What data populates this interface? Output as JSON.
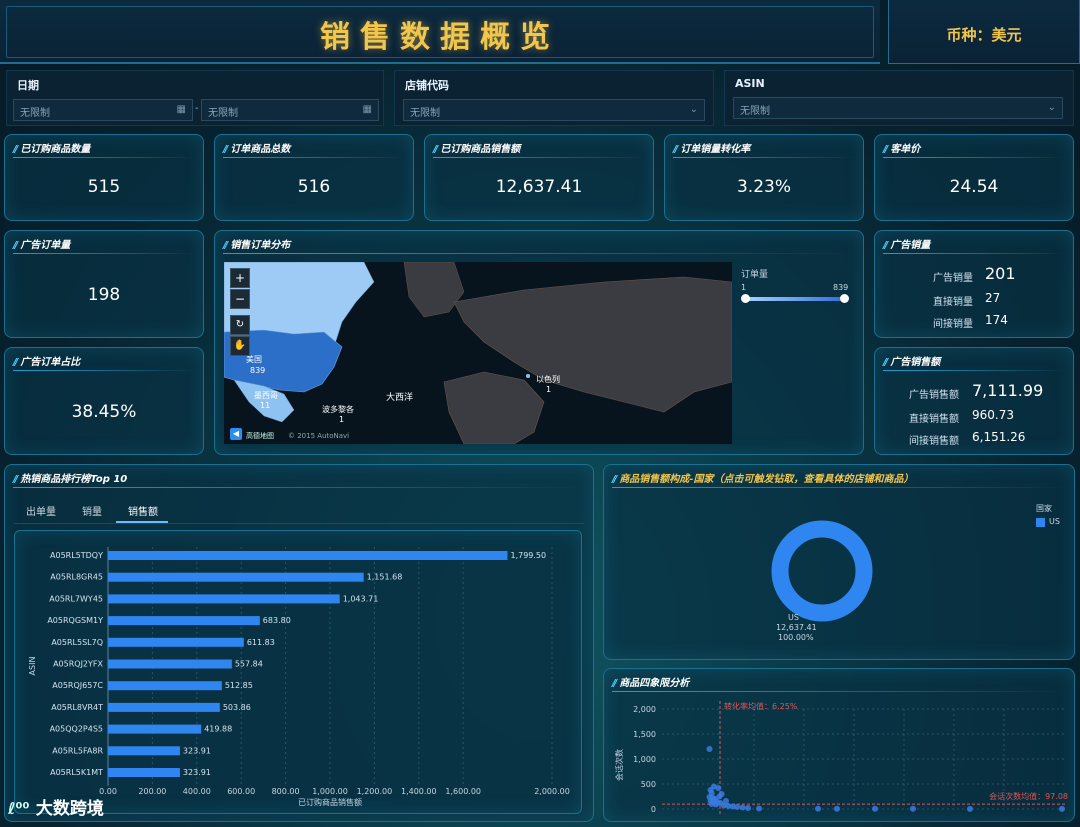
{
  "header": {
    "title": "销售数据概览",
    "currency": "币种：美元"
  },
  "filters": {
    "date": {
      "label": "日期",
      "start_placeholder": "无限制",
      "end_placeholder": "无限制",
      "sep": "-"
    },
    "store": {
      "label": "店铺代码",
      "value": "无限制"
    },
    "asin": {
      "label": "ASIN",
      "value": "无限制"
    }
  },
  "kpis": [
    {
      "title": "已订购商品数量",
      "value": "515"
    },
    {
      "title": "订单商品总数",
      "value": "516"
    },
    {
      "title": "已订购商品销售额",
      "value": "12,637.41"
    },
    {
      "title": "订单销量转化率",
      "value": "3.23%"
    },
    {
      "title": "客单价",
      "value": "24.54"
    }
  ],
  "ad_orders": {
    "title": "广告订单量",
    "value": "198"
  },
  "ad_ratio": {
    "title": "广告订单占比",
    "value": "38.45%"
  },
  "map": {
    "title": "销售订单分布",
    "legend_title": "订单量",
    "min": "1",
    "max": "839",
    "labels": {
      "us": "美国",
      "us_val": "839",
      "mx": "墨西哥",
      "mx_val": "11",
      "pr": "波多黎各",
      "pr_val": "1",
      "il": "以色列",
      "il_val": "1",
      "ocean": "大西洋"
    },
    "attribution": "高德地图",
    "copyright": "© 2015 AutoNavi"
  },
  "ad_sales_qty": {
    "title": "广告销量",
    "rows": [
      {
        "label": "广告销量",
        "value": "201"
      },
      {
        "label": "直接销量",
        "value": "27"
      },
      {
        "label": "间接销量",
        "value": "174"
      }
    ]
  },
  "ad_sales_amt": {
    "title": "广告销售额",
    "rows": [
      {
        "label": "广告销售额",
        "value": "7,111.99"
      },
      {
        "label": "直接销售额",
        "value": "960.73"
      },
      {
        "label": "间接销售额",
        "value": "6,151.26"
      }
    ]
  },
  "top10": {
    "title": "热销商品排行榜Top 10",
    "tabs": [
      "出单量",
      "销量",
      "销售额"
    ],
    "active_tab": 2
  },
  "pie": {
    "title": "商品销售额构成-国家（点击可触发钻取，查看具体的店铺和商品）",
    "legend_title": "国家",
    "legend_item": "US",
    "label": "US",
    "value": "12,637.41",
    "pct": "100.00%",
    "color": "#2f86f0"
  },
  "quad": {
    "title": "商品四象限分析",
    "ylabel": "会话次数",
    "mean_x": "转化率均值：6.25%",
    "mean_y": "会话次数均值：97.08",
    "yticks": [
      "2,000",
      "1,500",
      "1,000",
      "500",
      "0"
    ]
  },
  "chart_data": [
    {
      "type": "bar",
      "orientation": "horizontal",
      "categories": [
        "A05RL5TDQY",
        "A05RL8GR45",
        "A05RL7WY45",
        "A05RQGSM1Y",
        "A05RL5SL7Q",
        "A05RQJ2YFX",
        "A05RQJ657C",
        "A05RL8VR4T",
        "A05QQ2P4S5",
        "A05RL5FA8R",
        "A05RL5K1MT"
      ],
      "values": [
        1799.5,
        1151.68,
        1043.71,
        683.8,
        611.83,
        557.84,
        512.85,
        503.86,
        419.88,
        323.91,
        323.91
      ],
      "value_labels": [
        "1,799.50",
        "1,151.68",
        "1,043.71",
        "683.80",
        "611.83",
        "557.84",
        "512.85",
        "503.86",
        "419.88",
        "323.91",
        "323.91"
      ],
      "xlabel": "已订购商品销售额",
      "ylabel": "ASIN",
      "xticks": [
        "0.00",
        "200.00",
        "400.00",
        "600.00",
        "800.00",
        "1,000.00",
        "1,200.00",
        "1,400.00",
        "1,600.00",
        "2,000.00"
      ],
      "xlim": [
        0,
        2000
      ],
      "color": "#2f86f0"
    },
    {
      "type": "pie",
      "categories": [
        "US"
      ],
      "values": [
        12637.41
      ]
    },
    {
      "type": "scatter",
      "ylabel": "会话次数",
      "ylim": [
        0,
        2000
      ],
      "points": [
        [
          0.5,
          1200
        ],
        [
          0.6,
          380
        ],
        [
          0.7,
          320
        ],
        [
          0.5,
          240
        ],
        [
          0.8,
          220
        ],
        [
          1,
          200
        ],
        [
          0.9,
          180
        ],
        [
          0.6,
          160
        ],
        [
          1.2,
          140
        ],
        [
          1.5,
          120
        ],
        [
          0.7,
          100
        ],
        [
          1.1,
          90
        ],
        [
          1.8,
          70
        ],
        [
          2.2,
          60
        ],
        [
          2.6,
          50
        ],
        [
          3,
          40
        ],
        [
          3.5,
          30
        ],
        [
          4,
          20
        ],
        [
          5,
          10
        ],
        [
          6,
          8
        ],
        [
          7,
          6
        ],
        [
          9,
          5
        ],
        [
          11,
          4
        ],
        [
          14,
          3
        ],
        [
          20,
          2
        ],
        [
          1.3,
          420
        ],
        [
          1.6,
          300
        ],
        [
          2,
          160
        ],
        [
          0.9,
          450
        ],
        [
          1.4,
          250
        ]
      ],
      "color": "#3a7be0"
    }
  ]
}
